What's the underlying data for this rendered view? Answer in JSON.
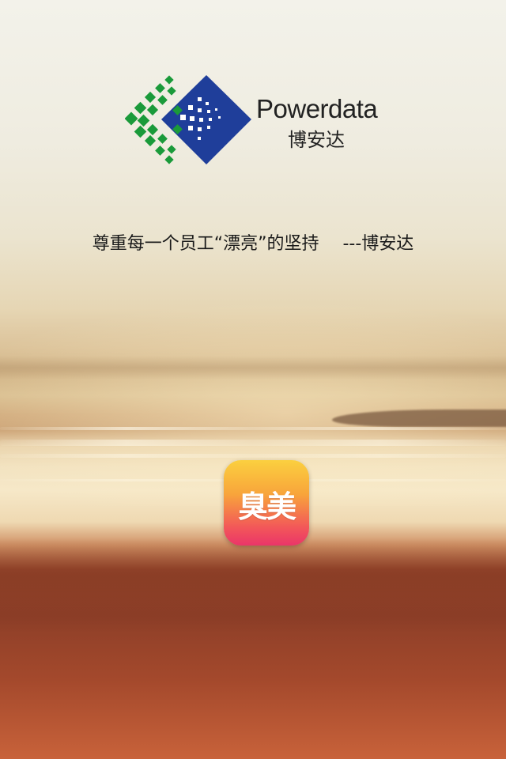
{
  "brand": {
    "name_en": "Powerdata",
    "name_cn": "博安达",
    "colors": {
      "green": "#1a9a3a",
      "blue": "#1f3e9a"
    }
  },
  "slogan": {
    "text": "尊重每一个员工“漂亮”的坚持",
    "signature": "---博安达"
  },
  "app_icon": {
    "label": "臭美",
    "icon": "app-logo-icon",
    "gradient_top": "#fbd03f",
    "gradient_bottom": "#ea3569"
  }
}
